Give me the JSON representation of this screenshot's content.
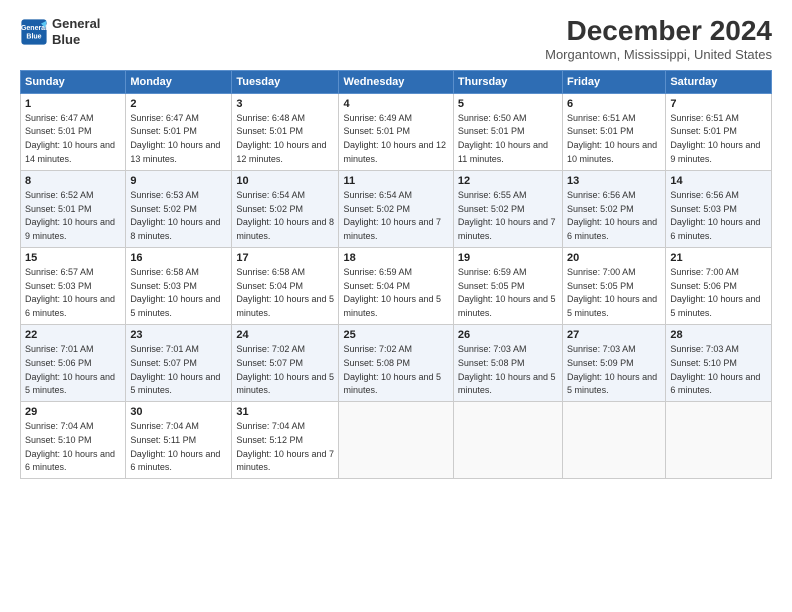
{
  "header": {
    "logo_line1": "General",
    "logo_line2": "Blue",
    "title": "December 2024",
    "subtitle": "Morgantown, Mississippi, United States"
  },
  "columns": [
    "Sunday",
    "Monday",
    "Tuesday",
    "Wednesday",
    "Thursday",
    "Friday",
    "Saturday"
  ],
  "weeks": [
    [
      {
        "day": "1",
        "sunrise": "Sunrise: 6:47 AM",
        "sunset": "Sunset: 5:01 PM",
        "daylight": "Daylight: 10 hours and 14 minutes."
      },
      {
        "day": "2",
        "sunrise": "Sunrise: 6:47 AM",
        "sunset": "Sunset: 5:01 PM",
        "daylight": "Daylight: 10 hours and 13 minutes."
      },
      {
        "day": "3",
        "sunrise": "Sunrise: 6:48 AM",
        "sunset": "Sunset: 5:01 PM",
        "daylight": "Daylight: 10 hours and 12 minutes."
      },
      {
        "day": "4",
        "sunrise": "Sunrise: 6:49 AM",
        "sunset": "Sunset: 5:01 PM",
        "daylight": "Daylight: 10 hours and 12 minutes."
      },
      {
        "day": "5",
        "sunrise": "Sunrise: 6:50 AM",
        "sunset": "Sunset: 5:01 PM",
        "daylight": "Daylight: 10 hours and 11 minutes."
      },
      {
        "day": "6",
        "sunrise": "Sunrise: 6:51 AM",
        "sunset": "Sunset: 5:01 PM",
        "daylight": "Daylight: 10 hours and 10 minutes."
      },
      {
        "day": "7",
        "sunrise": "Sunrise: 6:51 AM",
        "sunset": "Sunset: 5:01 PM",
        "daylight": "Daylight: 10 hours and 9 minutes."
      }
    ],
    [
      {
        "day": "8",
        "sunrise": "Sunrise: 6:52 AM",
        "sunset": "Sunset: 5:01 PM",
        "daylight": "Daylight: 10 hours and 9 minutes."
      },
      {
        "day": "9",
        "sunrise": "Sunrise: 6:53 AM",
        "sunset": "Sunset: 5:02 PM",
        "daylight": "Daylight: 10 hours and 8 minutes."
      },
      {
        "day": "10",
        "sunrise": "Sunrise: 6:54 AM",
        "sunset": "Sunset: 5:02 PM",
        "daylight": "Daylight: 10 hours and 8 minutes."
      },
      {
        "day": "11",
        "sunrise": "Sunrise: 6:54 AM",
        "sunset": "Sunset: 5:02 PM",
        "daylight": "Daylight: 10 hours and 7 minutes."
      },
      {
        "day": "12",
        "sunrise": "Sunrise: 6:55 AM",
        "sunset": "Sunset: 5:02 PM",
        "daylight": "Daylight: 10 hours and 7 minutes."
      },
      {
        "day": "13",
        "sunrise": "Sunrise: 6:56 AM",
        "sunset": "Sunset: 5:02 PM",
        "daylight": "Daylight: 10 hours and 6 minutes."
      },
      {
        "day": "14",
        "sunrise": "Sunrise: 6:56 AM",
        "sunset": "Sunset: 5:03 PM",
        "daylight": "Daylight: 10 hours and 6 minutes."
      }
    ],
    [
      {
        "day": "15",
        "sunrise": "Sunrise: 6:57 AM",
        "sunset": "Sunset: 5:03 PM",
        "daylight": "Daylight: 10 hours and 6 minutes."
      },
      {
        "day": "16",
        "sunrise": "Sunrise: 6:58 AM",
        "sunset": "Sunset: 5:03 PM",
        "daylight": "Daylight: 10 hours and 5 minutes."
      },
      {
        "day": "17",
        "sunrise": "Sunrise: 6:58 AM",
        "sunset": "Sunset: 5:04 PM",
        "daylight": "Daylight: 10 hours and 5 minutes."
      },
      {
        "day": "18",
        "sunrise": "Sunrise: 6:59 AM",
        "sunset": "Sunset: 5:04 PM",
        "daylight": "Daylight: 10 hours and 5 minutes."
      },
      {
        "day": "19",
        "sunrise": "Sunrise: 6:59 AM",
        "sunset": "Sunset: 5:05 PM",
        "daylight": "Daylight: 10 hours and 5 minutes."
      },
      {
        "day": "20",
        "sunrise": "Sunrise: 7:00 AM",
        "sunset": "Sunset: 5:05 PM",
        "daylight": "Daylight: 10 hours and 5 minutes."
      },
      {
        "day": "21",
        "sunrise": "Sunrise: 7:00 AM",
        "sunset": "Sunset: 5:06 PM",
        "daylight": "Daylight: 10 hours and 5 minutes."
      }
    ],
    [
      {
        "day": "22",
        "sunrise": "Sunrise: 7:01 AM",
        "sunset": "Sunset: 5:06 PM",
        "daylight": "Daylight: 10 hours and 5 minutes."
      },
      {
        "day": "23",
        "sunrise": "Sunrise: 7:01 AM",
        "sunset": "Sunset: 5:07 PM",
        "daylight": "Daylight: 10 hours and 5 minutes."
      },
      {
        "day": "24",
        "sunrise": "Sunrise: 7:02 AM",
        "sunset": "Sunset: 5:07 PM",
        "daylight": "Daylight: 10 hours and 5 minutes."
      },
      {
        "day": "25",
        "sunrise": "Sunrise: 7:02 AM",
        "sunset": "Sunset: 5:08 PM",
        "daylight": "Daylight: 10 hours and 5 minutes."
      },
      {
        "day": "26",
        "sunrise": "Sunrise: 7:03 AM",
        "sunset": "Sunset: 5:08 PM",
        "daylight": "Daylight: 10 hours and 5 minutes."
      },
      {
        "day": "27",
        "sunrise": "Sunrise: 7:03 AM",
        "sunset": "Sunset: 5:09 PM",
        "daylight": "Daylight: 10 hours and 5 minutes."
      },
      {
        "day": "28",
        "sunrise": "Sunrise: 7:03 AM",
        "sunset": "Sunset: 5:10 PM",
        "daylight": "Daylight: 10 hours and 6 minutes."
      }
    ],
    [
      {
        "day": "29",
        "sunrise": "Sunrise: 7:04 AM",
        "sunset": "Sunset: 5:10 PM",
        "daylight": "Daylight: 10 hours and 6 minutes."
      },
      {
        "day": "30",
        "sunrise": "Sunrise: 7:04 AM",
        "sunset": "Sunset: 5:11 PM",
        "daylight": "Daylight: 10 hours and 6 minutes."
      },
      {
        "day": "31",
        "sunrise": "Sunrise: 7:04 AM",
        "sunset": "Sunset: 5:12 PM",
        "daylight": "Daylight: 10 hours and 7 minutes."
      },
      null,
      null,
      null,
      null
    ]
  ]
}
